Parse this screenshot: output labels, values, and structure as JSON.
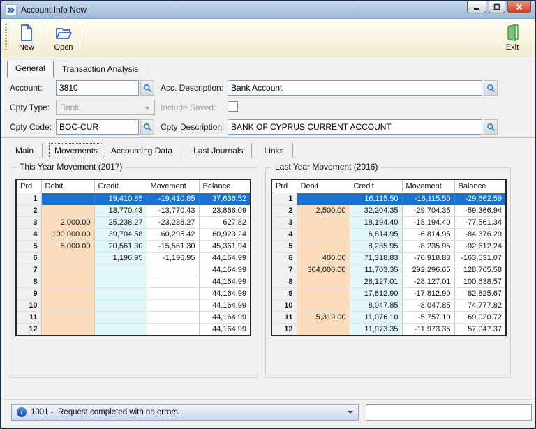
{
  "window": {
    "title": "Account Info New"
  },
  "toolbar": {
    "new_label": "New",
    "open_label": "Open",
    "exit_label": "Exit"
  },
  "tabs": {
    "items": [
      {
        "label": "General",
        "selected": true
      },
      {
        "label": "Transaction Analysis",
        "selected": false
      }
    ]
  },
  "form": {
    "account": {
      "label": "Account:",
      "value": "3810"
    },
    "acc_description": {
      "label": "Acc. Description:",
      "value": "Bank Account"
    },
    "cpty_type": {
      "label": "Cpty Type:",
      "value": "Bank",
      "disabled": true
    },
    "include_saved": {
      "label": "Include Saved:",
      "checked": false
    },
    "cpty_code": {
      "label": "Cpty Code:",
      "value": "BOC-CUR"
    },
    "cpty_description": {
      "label": "Cpty Description:",
      "value": "BANK OF CYPRUS CURRENT ACCOUNT"
    }
  },
  "subtabs": {
    "items": [
      {
        "label": "Main",
        "selected": false
      },
      {
        "label": "Movements",
        "selected": true
      },
      {
        "label": "Accounting Data",
        "selected": false
      },
      {
        "label": "Last Journals",
        "selected": false
      },
      {
        "label": "Links",
        "selected": false
      }
    ]
  },
  "movements": {
    "columns": [
      "Prd",
      "Debit",
      "Credit",
      "Movement",
      "Balance"
    ],
    "tables": [
      {
        "id": "this_year",
        "title": "This Year Movement (2017)",
        "rows": [
          {
            "prd": "1",
            "debit": "",
            "credit": "19,410.85",
            "movement": "-19,410.85",
            "balance": "37,636.52",
            "selected": true,
            "balance_class": ""
          },
          {
            "prd": "2",
            "debit": "",
            "credit": "13,770.43",
            "movement": "-13,770.43",
            "balance": "23,866.09",
            "selected": false,
            "balance_class": "pos"
          },
          {
            "prd": "3",
            "debit": "2,000.00",
            "credit": "25,238.27",
            "movement": "-23,238.27",
            "balance": "627.82",
            "selected": false,
            "balance_class": "pos"
          },
          {
            "prd": "4",
            "debit": "100,000.00",
            "credit": "39,704.58",
            "movement": "60,295.42",
            "balance": "60,923.24",
            "selected": false,
            "balance_class": "pos"
          },
          {
            "prd": "5",
            "debit": "5,000.00",
            "credit": "20,561.30",
            "movement": "-15,561.30",
            "balance": "45,361.94",
            "selected": false,
            "balance_class": "pos"
          },
          {
            "prd": "6",
            "debit": "",
            "credit": "1,196.95",
            "movement": "-1,196.95",
            "balance": "44,164.99",
            "selected": false,
            "balance_class": "pos"
          },
          {
            "prd": "7",
            "debit": "",
            "credit": "",
            "movement": "",
            "balance": "44,164.99",
            "selected": false,
            "balance_class": "muted"
          },
          {
            "prd": "8",
            "debit": "",
            "credit": "",
            "movement": "",
            "balance": "44,164.99",
            "selected": false,
            "balance_class": "muted"
          },
          {
            "prd": "9",
            "debit": "",
            "credit": "",
            "movement": "",
            "balance": "44,164.99",
            "selected": false,
            "balance_class": "muted"
          },
          {
            "prd": "10",
            "debit": "",
            "credit": "",
            "movement": "",
            "balance": "44,164.99",
            "selected": false,
            "balance_class": "muted"
          },
          {
            "prd": "11",
            "debit": "",
            "credit": "",
            "movement": "",
            "balance": "44,164.99",
            "selected": false,
            "balance_class": "muted"
          },
          {
            "prd": "12",
            "debit": "",
            "credit": "",
            "movement": "",
            "balance": "44,164.99",
            "selected": false,
            "balance_class": "muted"
          }
        ]
      },
      {
        "id": "last_year",
        "title": "Last Year Movement (2016)",
        "rows": [
          {
            "prd": "1",
            "debit": "",
            "credit": "16,115.50",
            "movement": "-16,115.50",
            "balance": "-29,662.59",
            "selected": true,
            "balance_class": ""
          },
          {
            "prd": "2",
            "debit": "2,500.00",
            "credit": "32,204.35",
            "movement": "-29,704.35",
            "balance": "-59,366.94",
            "selected": false,
            "balance_class": "neg"
          },
          {
            "prd": "3",
            "debit": "",
            "credit": "18,194.40",
            "movement": "-18,194.40",
            "balance": "-77,561.34",
            "selected": false,
            "balance_class": "neg"
          },
          {
            "prd": "4",
            "debit": "",
            "credit": "6,814.95",
            "movement": "-6,814.95",
            "balance": "-84,376.29",
            "selected": false,
            "balance_class": "neg"
          },
          {
            "prd": "5",
            "debit": "",
            "credit": "8,235.95",
            "movement": "-8,235.95",
            "balance": "-92,612.24",
            "selected": false,
            "balance_class": "neg"
          },
          {
            "prd": "6",
            "debit": "400.00",
            "credit": "71,318.83",
            "movement": "-70,918.83",
            "balance": "-163,531.07",
            "selected": false,
            "balance_class": "neg"
          },
          {
            "prd": "7",
            "debit": "304,000.00",
            "credit": "11,703.35",
            "movement": "292,296.65",
            "balance": "128,765.58",
            "selected": false,
            "balance_class": "pos"
          },
          {
            "prd": "8",
            "debit": "",
            "credit": "28,127.01",
            "movement": "-28,127.01",
            "balance": "100,638.57",
            "selected": false,
            "balance_class": "pos"
          },
          {
            "prd": "9",
            "debit": "",
            "credit": "17,812.90",
            "movement": "-17,812.90",
            "balance": "82,825.67",
            "selected": false,
            "balance_class": "pos"
          },
          {
            "prd": "10",
            "debit": "",
            "credit": "8,047.85",
            "movement": "-8,047.85",
            "balance": "74,777.82",
            "selected": false,
            "balance_class": "pos"
          },
          {
            "prd": "11",
            "debit": "5,319.00",
            "credit": "11,076.10",
            "movement": "-5,757.10",
            "balance": "69,020.72",
            "selected": false,
            "balance_class": "pos"
          },
          {
            "prd": "12",
            "debit": "",
            "credit": "11,973.35",
            "movement": "-11,973.35",
            "balance": "57,047.37",
            "selected": false,
            "balance_class": "pos"
          }
        ]
      }
    ]
  },
  "status": {
    "message": "1001 -  Request completed with no errors."
  },
  "colors": {
    "selected_row": "#1773d1",
    "debit_bg": "#fbdcba",
    "credit_bg": "#e2f7f9",
    "balance_positive": "#3939b8",
    "balance_negative": "#c23a3a",
    "balance_inactive": "#c6c6c6",
    "toolbar_bg": "#f6f0d8",
    "titlebar_bg": "#aec7e2"
  }
}
